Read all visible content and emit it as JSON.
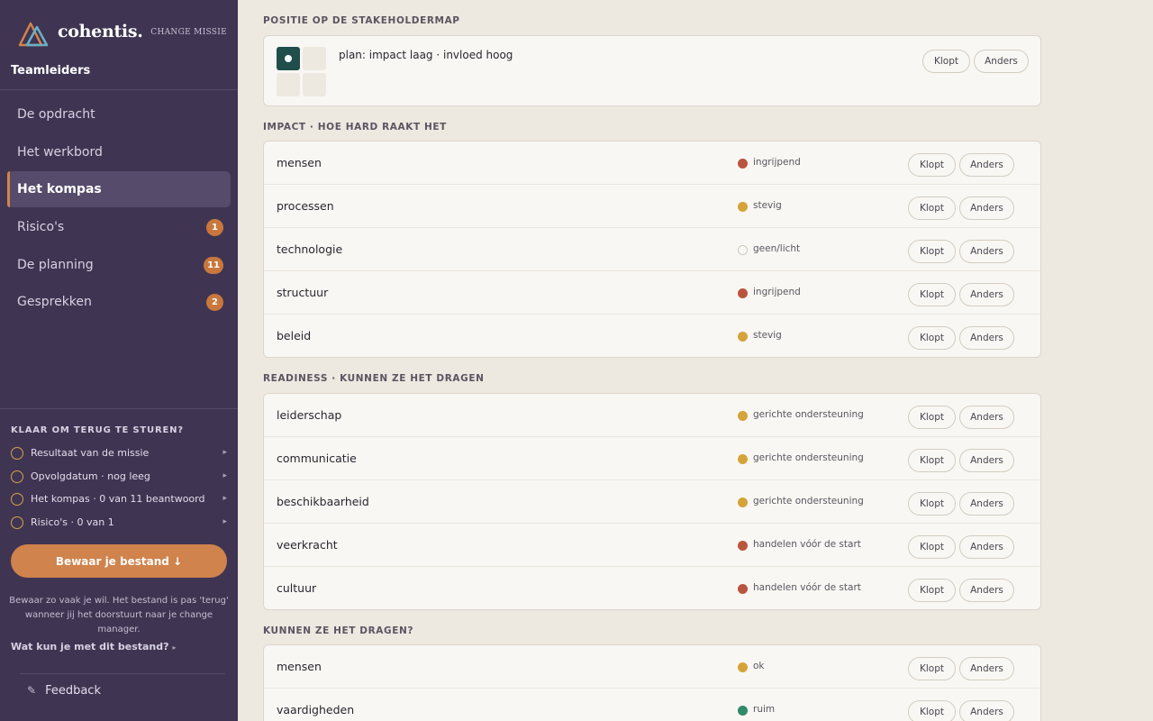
{
  "brand": {
    "name": "cohentis.",
    "change_label": "CHANGE MISSIE"
  },
  "team": "Teamleiders",
  "nav": [
    {
      "label": "De opdracht",
      "badge": null
    },
    {
      "label": "Het werkbord",
      "badge": null
    },
    {
      "label": "Het kompas",
      "badge": null,
      "active": true
    },
    {
      "label": "Risico's",
      "badge": "1"
    },
    {
      "label": "De planning",
      "badge": "11"
    },
    {
      "label": "Gesprekken",
      "badge": "2"
    }
  ],
  "checklist": {
    "title": "KLAAR OM TERUG TE STUREN?",
    "items": [
      "Resultaat van de missie",
      "Opvolgdatum · nog leeg",
      "Het kompas · 0 van 11 beantwoord",
      "Risico's · 0 van 1"
    ]
  },
  "save_button": "Bewaar je bestand ↓",
  "save_note": "Bewaar zo vaak je wil. Het bestand is pas 'terug' wanneer jij het doorstuurt naar je change manager.",
  "help_link": "Wat kun je met dit bestand?",
  "help_arrow": "▸",
  "feedback": "Feedback",
  "buttons": {
    "confirm": "Klopt",
    "other": "Anders"
  },
  "stakeholder": {
    "title": "POSITIE OP DE STAKEHOLDERMAP",
    "text": "plan: impact laag · invloed hoog"
  },
  "colors": {
    "red": "#b9553e",
    "yellow": "#d4a43b",
    "green": "#2f8a6a"
  },
  "sections": [
    {
      "title": "IMPACT · HOE HARD RAAKT HET",
      "rows": [
        {
          "label": "mensen",
          "status": "ingrijpend",
          "level": "red"
        },
        {
          "label": "processen",
          "status": "stevig",
          "level": "yellow"
        },
        {
          "label": "technologie",
          "status": "geen/licht",
          "level": "empty"
        },
        {
          "label": "structuur",
          "status": "ingrijpend",
          "level": "red"
        },
        {
          "label": "beleid",
          "status": "stevig",
          "level": "yellow"
        }
      ]
    },
    {
      "title": "READINESS · KUNNEN ZE HET DRAGEN",
      "rows": [
        {
          "label": "leiderschap",
          "status": "gerichte ondersteuning",
          "level": "yellow"
        },
        {
          "label": "communicatie",
          "status": "gerichte ondersteuning",
          "level": "yellow"
        },
        {
          "label": "beschikbaarheid",
          "status": "gerichte ondersteuning",
          "level": "yellow"
        },
        {
          "label": "veerkracht",
          "status": "handelen vóór de start",
          "level": "red"
        },
        {
          "label": "cultuur",
          "status": "handelen vóór de start",
          "level": "red"
        }
      ]
    },
    {
      "title": "KUNNEN ZE HET DRAGEN?",
      "rows": [
        {
          "label": "mensen",
          "status": "ok",
          "level": "yellow"
        },
        {
          "label": "vaardigheden",
          "status": "ruim",
          "level": "green"
        }
      ]
    }
  ]
}
